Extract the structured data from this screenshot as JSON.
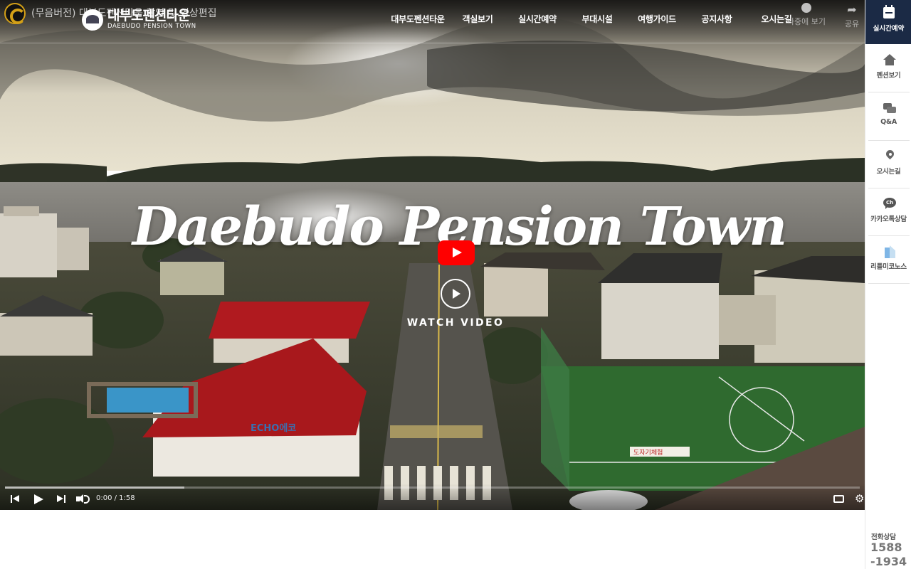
{
  "video": {
    "title": "(무음버전) 대부도펜션타운 촬영 및 영상편집",
    "watch_later_label": "나중에 보기",
    "share_label": "공유",
    "current_time": "0:00",
    "duration": "1:58",
    "time_display": "0:00 / 1:58",
    "buffered_fraction": 0.21
  },
  "site": {
    "logo_kr": "대부도펜션타운",
    "logo_en": "DAEBUDO PENSION TOWN",
    "nav": [
      "대부도펜션타운",
      "객실보기",
      "실시간예약",
      "부대시설",
      "여행가이드",
      "공지사항",
      "오시는길"
    ]
  },
  "hero": {
    "script_title": "Daebudo Pension Town",
    "watch_label": "WATCH VIDEO"
  },
  "scene_signs": {
    "echo": "ECHO에코",
    "banner": "도자기체험"
  },
  "quick_menu": {
    "top_label": "실시간예약",
    "items": [
      "펜션보기",
      "Q&A",
      "오시는길",
      "카카오톡상담",
      "리틀미코노스"
    ],
    "phone_label": "전화상담",
    "phone_line1": "1588",
    "phone_line2": "-1934"
  },
  "colors": {
    "quick_top_bg": "#1b2a45",
    "youtube_red": "#ff0000",
    "channel_gold": "#d4a017"
  },
  "icons": [
    "calendar-icon",
    "home-icon",
    "qa-icon",
    "pin-icon",
    "kakao-icon",
    "little-mykonos-icon",
    "clock-icon",
    "share-icon",
    "settings-icon"
  ]
}
